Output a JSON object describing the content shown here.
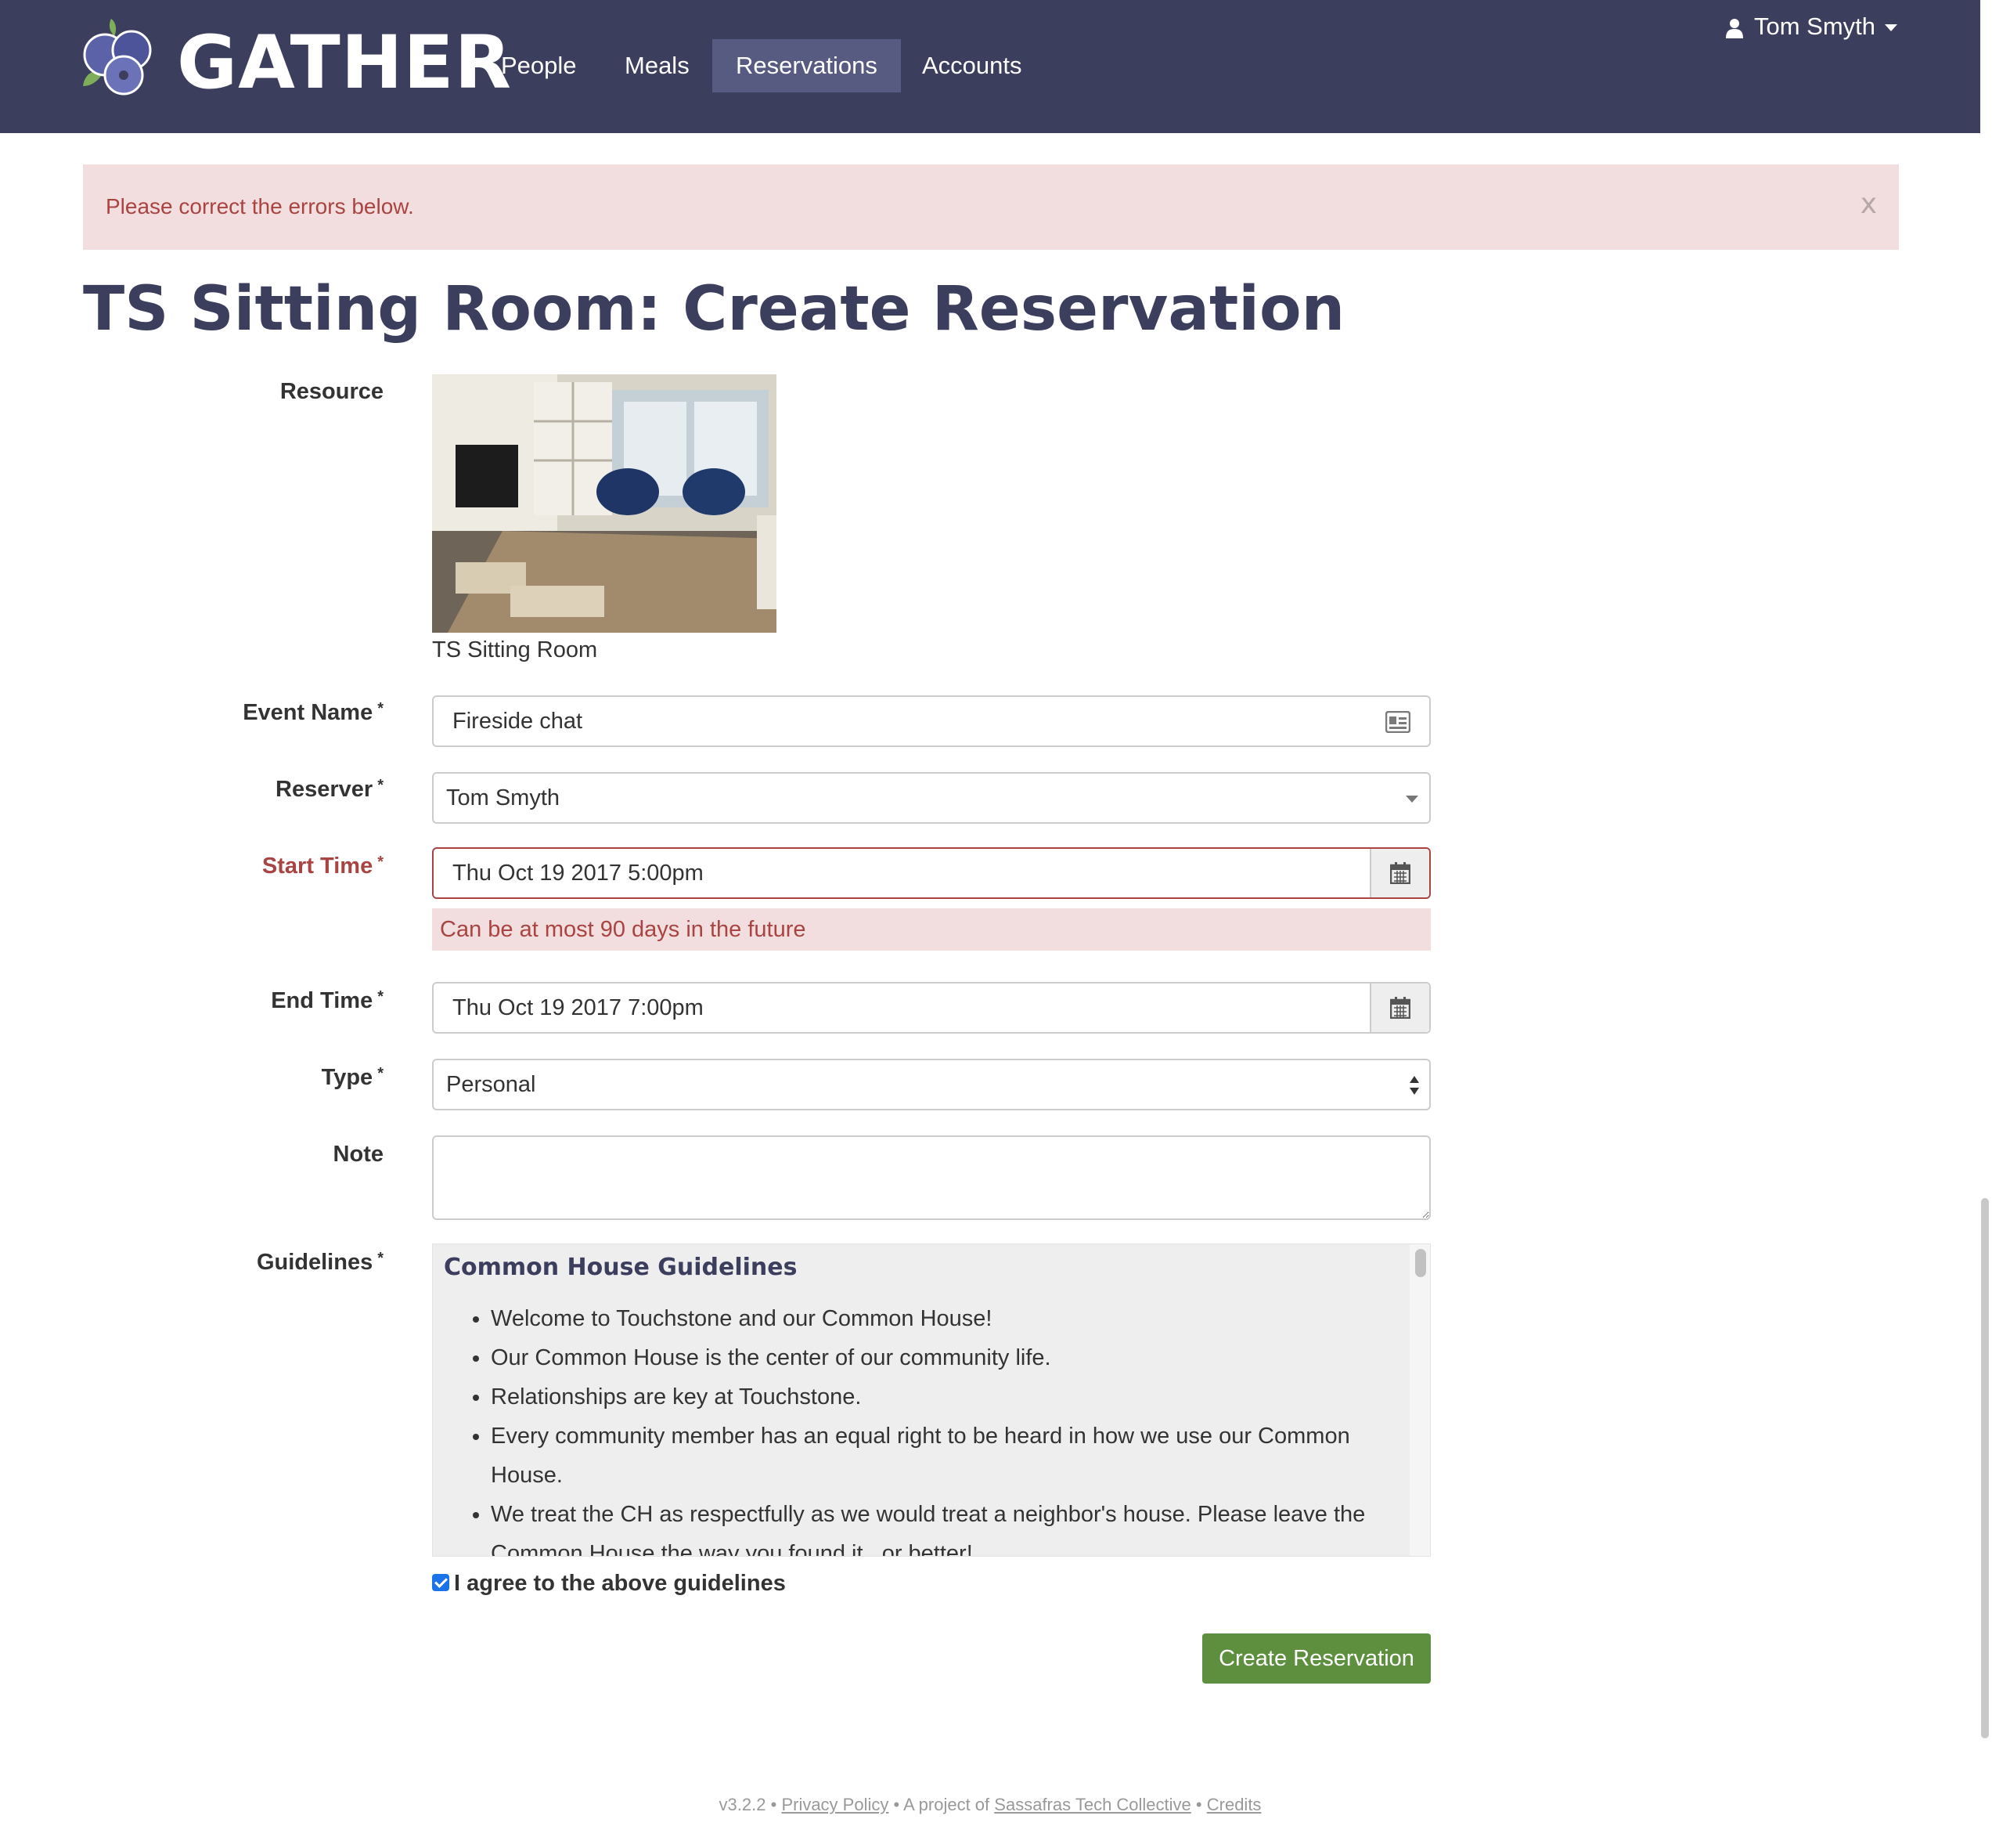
{
  "header": {
    "brand": "GATHER",
    "nav": [
      {
        "label": "People",
        "active": false
      },
      {
        "label": "Meals",
        "active": false
      },
      {
        "label": "Reservations",
        "active": true
      },
      {
        "label": "Accounts",
        "active": false
      }
    ],
    "user_name": "Tom Smyth",
    "colors": {
      "bar": "#3b3e5c",
      "active": "#575b82"
    }
  },
  "alert": {
    "text": "Please correct the errors below.",
    "close": "x"
  },
  "page_title": "TS Sitting Room: Create Reservation",
  "form": {
    "resource": {
      "label": "Resource",
      "caption": "TS Sitting Room"
    },
    "event_name": {
      "label": "Event Name",
      "value": "Fireside chat"
    },
    "reserver": {
      "label": "Reserver",
      "value": "Tom Smyth"
    },
    "start_time": {
      "label": "Start Time",
      "value": "Thu Oct 19 2017 5:00pm",
      "error": "Can be at most 90 days in the future"
    },
    "end_time": {
      "label": "End Time",
      "value": "Thu Oct 19 2017 7:00pm"
    },
    "type": {
      "label": "Type",
      "value": "Personal"
    },
    "note": {
      "label": "Note",
      "value": ""
    },
    "guidelines": {
      "label": "Guidelines",
      "title": "Common House Guidelines",
      "items": [
        "Welcome to Touchstone and our Common House!",
        "Our Common House is the center of our community life.",
        "Relationships are key at Touchstone.",
        "Every community member has an equal right to be heard in how we use our Common House.",
        "We treat the CH as respectfully as we would treat a neighbor's house. Please leave the Common House the way you found it...or better!"
      ]
    },
    "agree": {
      "label": "I agree to the above guidelines",
      "checked": true
    },
    "required_mark": "*",
    "submit_label": "Create Reservation"
  },
  "footer": {
    "version": "v3.2.2",
    "sep": "•",
    "privacy": "Privacy Policy",
    "project_prefix": "A project of",
    "org": "Sassafras Tech Collective",
    "credits": "Credits"
  },
  "icons": [
    "user-icon",
    "id-card-icon",
    "calendar-icon",
    "chevron-down-icon",
    "close-icon",
    "blueberry-logo-icon"
  ]
}
